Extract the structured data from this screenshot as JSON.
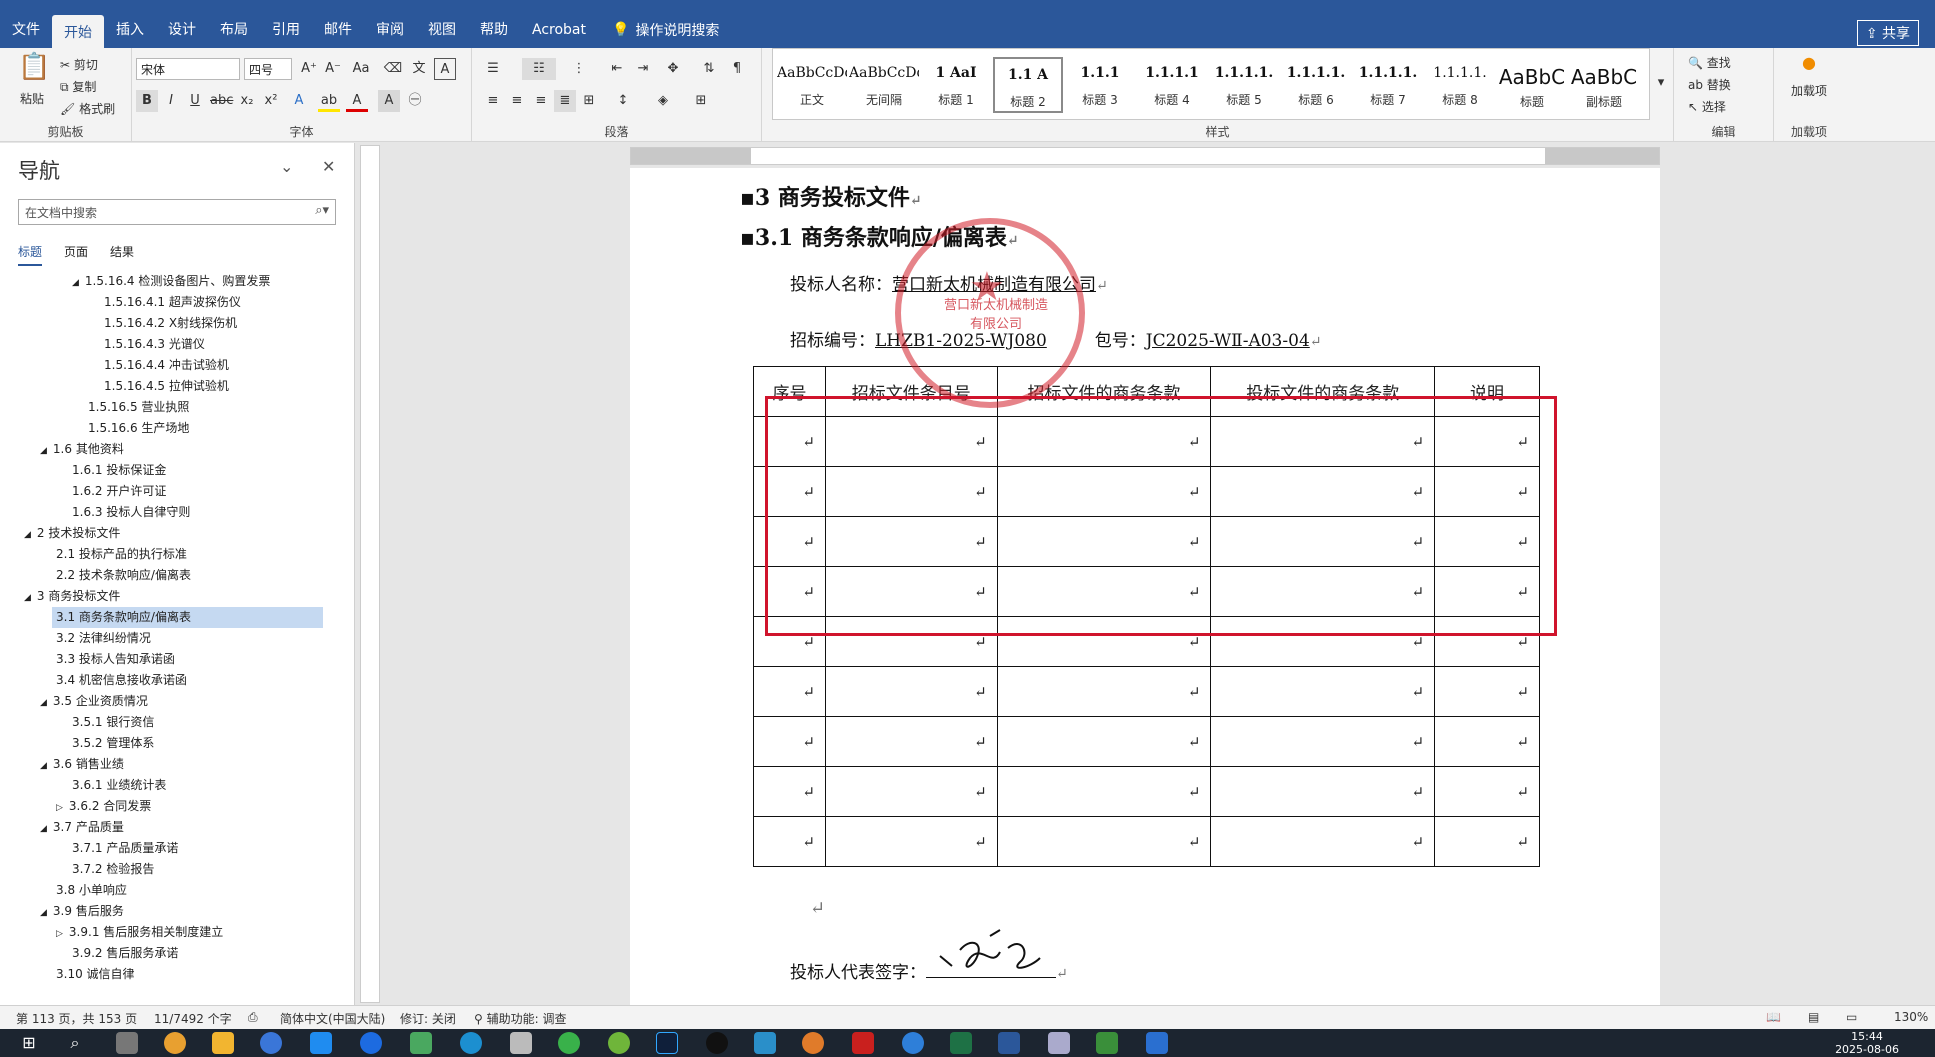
{
  "tabs": [
    "文件",
    "开始",
    "插入",
    "设计",
    "布局",
    "引用",
    "邮件",
    "审阅",
    "视图",
    "帮助",
    "Acrobat"
  ],
  "tell_me": "操作说明搜索",
  "share": "共享",
  "ribbon": {
    "clipboard": {
      "paste": "粘贴",
      "cut": "剪切",
      "copy": "复制",
      "format_painter": "格式刷",
      "label": "剪贴板"
    },
    "font": {
      "name": "宋体",
      "size": "四号",
      "label": "字体"
    },
    "paragraph": {
      "label": "段落"
    },
    "styles": {
      "label": "样式",
      "items": [
        {
          "sample": "AaBbCcDdI",
          "name": "正文"
        },
        {
          "sample": "AaBbCcDdI",
          "name": "无间隔"
        },
        {
          "sample": "1 AaI",
          "name": "标题 1"
        },
        {
          "sample": "1.1 A",
          "name": "标题 2"
        },
        {
          "sample": "1.1.1",
          "name": "标题 3"
        },
        {
          "sample": "1.1.1.1",
          "name": "标题 4"
        },
        {
          "sample": "1.1.1.1.",
          "name": "标题 5"
        },
        {
          "sample": "1.1.1.1.",
          "name": "标题 6"
        },
        {
          "sample": "1.1.1.1.",
          "name": "标题 7"
        },
        {
          "sample": "1.1.1.1.",
          "name": "标题 8"
        },
        {
          "sample": "AaBbC",
          "name": "标题"
        },
        {
          "sample": "AaBbC",
          "name": "副标题"
        }
      ]
    },
    "editing": {
      "find": "查找",
      "replace": "替换",
      "select": "选择",
      "label": "编辑"
    },
    "addins": {
      "name": "加载项",
      "label": "加载项"
    }
  },
  "nav": {
    "title": "导航",
    "search_placeholder": "在文档中搜索",
    "tabs": [
      "标题",
      "页面",
      "结果"
    ],
    "items": [
      {
        "text": "1.5.16.4 检测设备图片、购置发票"
      },
      {
        "text": "1.5.16.4.1 超声波探伤仪"
      },
      {
        "text": "1.5.16.4.2 X射线探伤机"
      },
      {
        "text": "1.5.16.4.3 光谱仪"
      },
      {
        "text": "1.5.16.4.4 冲击试验机"
      },
      {
        "text": "1.5.16.4.5 拉伸试验机"
      },
      {
        "text": "1.5.16.5 营业执照"
      },
      {
        "text": "1.5.16.6 生产场地"
      },
      {
        "text": "1.6 其他资料"
      },
      {
        "text": "1.6.1 投标保证金"
      },
      {
        "text": "1.6.2 开户许可证"
      },
      {
        "text": "1.6.3 投标人自律守则"
      },
      {
        "text": "2 技术投标文件"
      },
      {
        "text": "2.1 投标产品的执行标准"
      },
      {
        "text": "2.2 技术条款响应/偏离表"
      },
      {
        "text": "3 商务投标文件"
      },
      {
        "text": "3.1 商务条款响应/偏离表"
      },
      {
        "text": "3.2 法律纠纷情况"
      },
      {
        "text": "3.3 投标人告知承诺函"
      },
      {
        "text": "3.4 机密信息接收承诺函"
      },
      {
        "text": "3.5 企业资质情况"
      },
      {
        "text": "3.5.1 银行资信"
      },
      {
        "text": "3.5.2 管理体系"
      },
      {
        "text": "3.6 销售业绩"
      },
      {
        "text": "3.6.1 业绩统计表"
      },
      {
        "text": "3.6.2 合同发票"
      },
      {
        "text": "3.7 产品质量"
      },
      {
        "text": "3.7.1 产品质量承诺"
      },
      {
        "text": "3.7.2 检验报告"
      },
      {
        "text": "3.8 小单响应"
      },
      {
        "text": "3.9 售后服务"
      },
      {
        "text": "3.9.1 售后服务相关制度建立"
      },
      {
        "text": "3.9.2 售后服务承诺"
      },
      {
        "text": "3.10 诚信自律"
      }
    ]
  },
  "doc": {
    "h1": "3 商务投标文件",
    "h2": "3.1 商务条款响应/偏离表",
    "bidder_label": "投标人名称：",
    "bidder_name": "营口新太机械制造有限公司",
    "bid_no_label": "招标编号：",
    "bid_no": "LHZB1-2025-WJ080",
    "pkg_label": "包号：",
    "pkg": "JC2025-WⅡ-A03-04",
    "table_headers": [
      "序号",
      "招标文件条目号",
      "招标文件的商务条款",
      "投标文件的商务条款",
      "说明"
    ],
    "sign_label": "投标人代表签字：",
    "stamp_text": "营口新太机械制造有限公司"
  },
  "status": {
    "page": "第 113 页，共 153 页",
    "words": "11/7492 个字",
    "lang": "简体中文(中国大陆)",
    "track": "修订: 关闭",
    "access": "辅助功能: 调查",
    "zoom": "130%"
  },
  "clock": {
    "time": "15:44",
    "date": "2025-08-06"
  }
}
